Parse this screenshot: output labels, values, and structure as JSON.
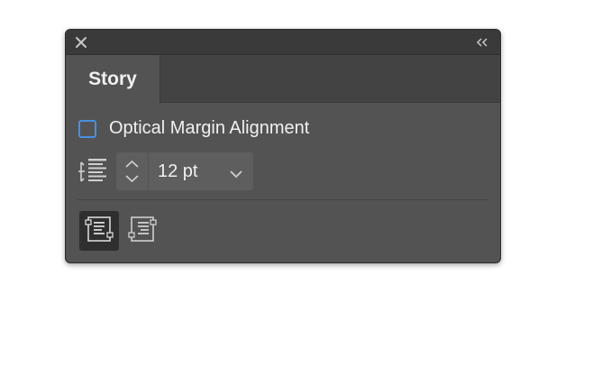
{
  "panel": {
    "tab_label": "Story",
    "optical_margin": {
      "label": "Optical Margin Alignment",
      "checked": false
    },
    "size": {
      "value": "12 pt",
      "icon": "leading-size-icon"
    },
    "frame_buttons": [
      {
        "icon": "text-frame-center-icon",
        "active": true
      },
      {
        "icon": "text-frame-right-icon",
        "active": false
      }
    ]
  },
  "titlebar": {
    "close_icon": "close-icon",
    "collapse_icon": "double-chevron-left-icon"
  },
  "colors": {
    "panel_bg": "#535353",
    "titlebar_bg": "#3a3a3a",
    "checkbox_accent": "#4a8fe0",
    "text": "#f0f0f0"
  }
}
